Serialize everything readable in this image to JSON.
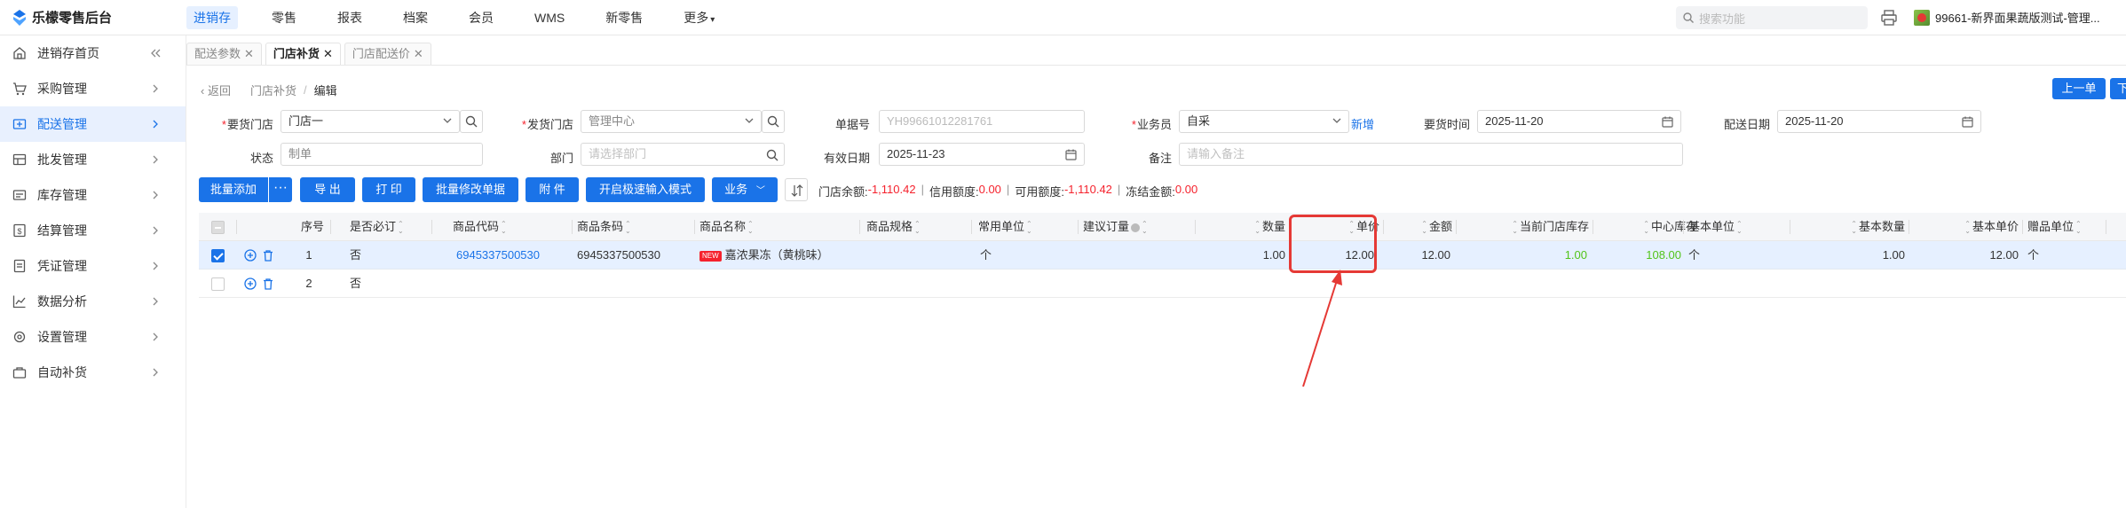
{
  "app": {
    "logo_text": "乐檬零售后台",
    "search_placeholder": "搜索功能",
    "user_name": "99661-新界面果蔬版测试-管理..."
  },
  "top_nav": [
    {
      "label": "进销存",
      "active": true
    },
    {
      "label": "零售"
    },
    {
      "label": "报表"
    },
    {
      "label": "档案"
    },
    {
      "label": "会员"
    },
    {
      "label": "WMS"
    },
    {
      "label": "新零售"
    },
    {
      "label": "更多"
    }
  ],
  "sidebar": [
    {
      "label": "进销存首页"
    },
    {
      "label": "采购管理"
    },
    {
      "label": "配送管理",
      "active": true
    },
    {
      "label": "批发管理"
    },
    {
      "label": "库存管理"
    },
    {
      "label": "结算管理"
    },
    {
      "label": "凭证管理"
    },
    {
      "label": "数据分析"
    },
    {
      "label": "设置管理"
    },
    {
      "label": "自动补货"
    }
  ],
  "tabs": [
    {
      "label": "配送参数"
    },
    {
      "label": "门店补货",
      "active": true
    },
    {
      "label": "门店配送价"
    }
  ],
  "breadcrumb": {
    "back": "返回",
    "parent": "门店补货",
    "separator": "/",
    "current": "编辑"
  },
  "page_nav": {
    "prev": "上一单",
    "next": "下"
  },
  "form": {
    "order_store_label": "要货门店",
    "order_store_value": "门店一",
    "ship_store_label": "发货门店",
    "ship_store_value": "管理中心",
    "doc_no_label": "单据号",
    "doc_no_value": "YH99661012281761",
    "salesman_label": "业务员",
    "salesman_value": "自采",
    "new_link": "新增",
    "order_time_label": "要货时间",
    "order_time_value": "2025-11-20",
    "ship_date_label": "配送日期",
    "ship_date_value": "2025-11-20",
    "status_label": "状态",
    "status_value": "制单",
    "dept_label": "部门",
    "dept_placeholder": "请选择部门",
    "valid_date_label": "有效日期",
    "valid_date_value": "2025-11-23",
    "remark_label": "备注",
    "remark_placeholder": "请输入备注"
  },
  "toolbar": {
    "batch_add": "批量添加",
    "more": "···",
    "export": "导 出",
    "print": "打 印",
    "batch_edit": "批量修改单据",
    "attachment": "附 件",
    "fast_input": "开启极速输入模式",
    "business": "业务",
    "store_balance_label": "门店余额:",
    "store_balance_value": "-1,110.42",
    "credit_label": "信用额度:",
    "credit_value": "0.00",
    "available_label": "可用额度:",
    "available_value": "-1,110.42",
    "frozen_label": "冻结金额:",
    "frozen_value": "0.00",
    "sep": "|"
  },
  "grid": {
    "headers": {
      "seq": "序号",
      "required": "是否必订",
      "code": "商品代码",
      "barcode": "商品条码",
      "name": "商品名称",
      "spec": "商品规格",
      "unit": "常用单位",
      "suggest": "建议订量",
      "qty": "数量",
      "price": "单价",
      "amount": "金额",
      "store_stock": "当前门店库存",
      "center_stock": "中心库存",
      "base_unit": "基本单位",
      "base_qty": "基本数量",
      "base_price": "基本单价",
      "gift_unit": "赠品单位"
    },
    "rows": [
      {
        "seq": "1",
        "required": "否",
        "code": "6945337500530",
        "barcode": "6945337500530",
        "badge": "NEW",
        "name": "嘉浓果冻（黄桃味）",
        "unit": "个",
        "qty": "1.00",
        "price": "12.00",
        "amount": "12.00",
        "store_stock": "1.00",
        "center_stock": "108.00",
        "base_unit": "个",
        "base_qty": "1.00",
        "base_price": "12.00",
        "gift_unit": "个"
      },
      {
        "seq": "2",
        "required": "否"
      }
    ]
  },
  "colors": {
    "primary": "#1a73e8",
    "negative": "#f5222d",
    "positive": "#52c41a",
    "annotation": "#e53935"
  }
}
